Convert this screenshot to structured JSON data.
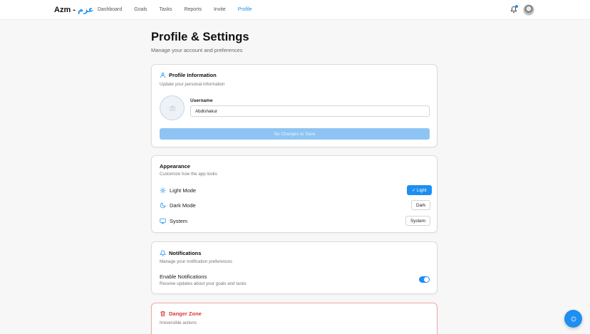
{
  "app": {
    "logo_latin": "Azm -",
    "logo_arabic": "عزم"
  },
  "nav": {
    "items": [
      {
        "label": "Dashboard"
      },
      {
        "label": "Goals"
      },
      {
        "label": "Tasks"
      },
      {
        "label": "Reports"
      },
      {
        "label": "Invite"
      },
      {
        "label": "Profile",
        "active": true
      }
    ]
  },
  "header": {
    "title": "Profile & Settings",
    "subtitle": "Manage your account and preferences"
  },
  "profile": {
    "title": "Profile Information",
    "subtitle": "Update your personal information",
    "username_label": "Username",
    "username_value": "Abdishakur",
    "save_label": "No Changes to Save"
  },
  "appearance": {
    "title": "Appearance",
    "subtitle": "Customize how the app looks",
    "options": [
      {
        "label": "Light Mode",
        "button": "✓ Light",
        "active": true,
        "icon": "sun-icon"
      },
      {
        "label": "Dark Mode",
        "button": "Dark",
        "active": false,
        "icon": "moon-icon"
      },
      {
        "label": "System",
        "button": "System",
        "active": false,
        "icon": "monitor-icon"
      }
    ]
  },
  "notifications": {
    "title": "Notifications",
    "subtitle": "Manage your notification preferences",
    "enable_label": "Enable Notifications",
    "enable_sub": "Receive updates about your goals and tasks",
    "enabled": true
  },
  "danger": {
    "title": "Danger Zone",
    "subtitle": "Irreversible actions"
  },
  "colors": {
    "accent": "#1d8ff0",
    "danger": "#d63a3a"
  }
}
